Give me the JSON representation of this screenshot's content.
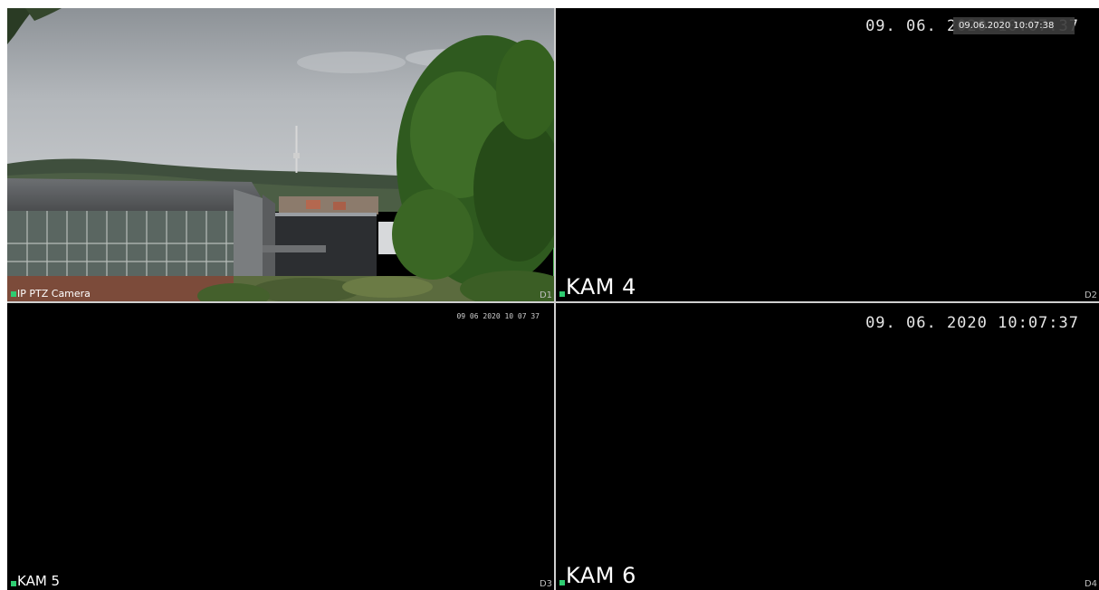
{
  "channels": [
    {
      "id": "D1",
      "name": "IP PTZ Camera",
      "timestamp": "",
      "selected": true
    },
    {
      "id": "D2",
      "name": "KAM 4",
      "timestamp": "09. 06. 2020 10:07:37",
      "selected": false
    },
    {
      "id": "D3",
      "name": "KAM 5",
      "timestamp": "09 06 2020 10 07 37",
      "selected": false
    },
    {
      "id": "D4",
      "name": "KAM 6",
      "timestamp": "09. 06. 2020 10:07:37",
      "selected": false
    }
  ],
  "system_clock": "09.06.2020 10:07:38",
  "colors": {
    "recording_indicator": "#2ecc71",
    "selected_border": "#4caf50",
    "background": "#000000"
  }
}
